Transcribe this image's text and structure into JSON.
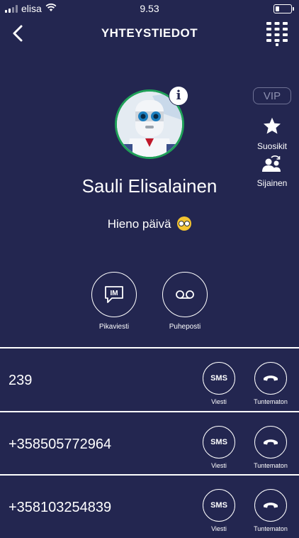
{
  "status_bar": {
    "carrier": "elisa",
    "time": "9.53"
  },
  "header": {
    "title": "YHTEYSTIEDOT"
  },
  "profile": {
    "name": "Sauli Elisalainen",
    "status_message": "Hieno päivä",
    "info_badge": "i"
  },
  "side_actions": {
    "vip_label": "VIP",
    "favorites_label": "Suosikit",
    "location_label": "Sijainen"
  },
  "actions": {
    "im_label": "Pikaviesti",
    "im_icon_text": "IM",
    "voicemail_label": "Puheposti"
  },
  "numbers": [
    {
      "number": "239",
      "sms_icon": "SMS",
      "sms_label": "Viesti",
      "call_label": "Tuntematon"
    },
    {
      "number": "+358505772964",
      "sms_icon": "SMS",
      "sms_label": "Viesti",
      "call_label": "Tuntematon"
    },
    {
      "number": "+358103254839",
      "sms_icon": "SMS",
      "sms_label": "Viesti",
      "call_label": "Tuntematon"
    }
  ],
  "icons": {
    "back": "chevron-left-icon",
    "keypad": "dialpad-icon",
    "favorites": "star-icon",
    "location": "person-swap-icon",
    "voicemail": "voicemail-icon",
    "call": "phone-handset-icon"
  },
  "colors": {
    "background": "#232650",
    "avatar_ring": "#1fa058",
    "text": "#ffffff"
  }
}
